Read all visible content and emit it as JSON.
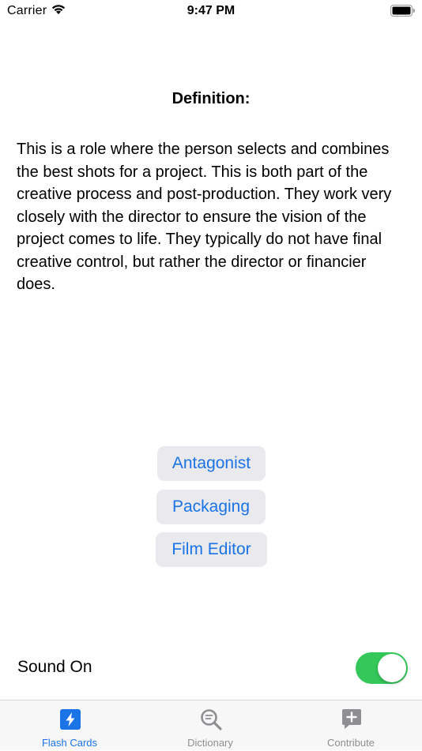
{
  "status_bar": {
    "carrier": "Carrier",
    "time": "9:47 PM"
  },
  "definition": {
    "title": "Definition:",
    "text": "This is a role where the person selects and combines the best shots for a project. This is both part of the creative process and post-production. They work very closely with the director to ensure the vision of the project comes to life. They typically do not have final creative control, but rather the director or financier does."
  },
  "answers": [
    {
      "label": "Antagonist"
    },
    {
      "label": "Packaging"
    },
    {
      "label": "Film Editor"
    }
  ],
  "sound": {
    "label": "Sound On",
    "on": true
  },
  "tabs": [
    {
      "label": "Flash Cards",
      "icon": "flash-cards-icon",
      "active": true
    },
    {
      "label": "Dictionary",
      "icon": "dictionary-search-icon",
      "active": false
    },
    {
      "label": "Contribute",
      "icon": "contribute-plus-icon",
      "active": false
    }
  ],
  "colors": {
    "accent": "#1a74e8",
    "toggle_on": "#34c759",
    "button_bg": "#e9e9ee",
    "inactive_tab": "#8e8e93"
  }
}
